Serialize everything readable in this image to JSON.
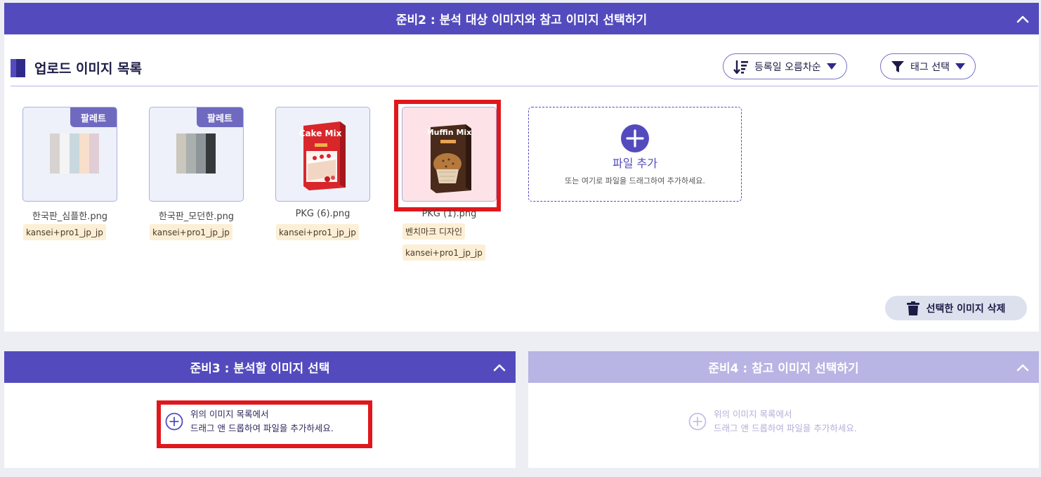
{
  "prep2": {
    "header": "준비2 : 분석 대상 이미지와 참고 이미지 선택하기",
    "section_title": "업로드 이미지 목록",
    "sort_label": "등록일 오름차순",
    "tag_filter_label": "태그 선택",
    "images": [
      {
        "filename": "한국판_심플한.png",
        "badge": "팔레트",
        "tags": [
          "kansei+pro1_jp_jp"
        ]
      },
      {
        "filename": "한국판_모던한.png",
        "badge": "팔레트",
        "tags": [
          "kansei+pro1_jp_jp"
        ]
      },
      {
        "filename": "PKG (6).png",
        "tags": [
          "kansei+pro1_jp_jp"
        ],
        "box_title": "Cake Mix"
      },
      {
        "filename": "PKG (1).png",
        "tags": [
          "벤치마크 디자인",
          "kansei+pro1_jp_jp"
        ],
        "box_title": "Muffin Mix"
      }
    ],
    "add_file": {
      "title": "파일 추가",
      "hint": "또는 여기로 파일을 드래그하여 추가하세요."
    },
    "delete_label": "선택한 이미지 삭제"
  },
  "prep3": {
    "header": "준비3 : 분석할 이미지 선택",
    "hint_line1": "위의 이미지 목록에서",
    "hint_line2": "드래그 앤 드롭하여 파일을 추가하세요."
  },
  "prep4": {
    "header": "준비4 : 참고 이미지 선택하기",
    "hint_line1": "위의 이미지 목록에서",
    "hint_line2": "드래그 앤 드롭하여 파일을 추가하세요."
  },
  "colors": {
    "accent": "#534bbd",
    "accent_disabled": "#b8b4e4",
    "highlight": "#e0171c",
    "tag_bg": "#fcefd6"
  }
}
